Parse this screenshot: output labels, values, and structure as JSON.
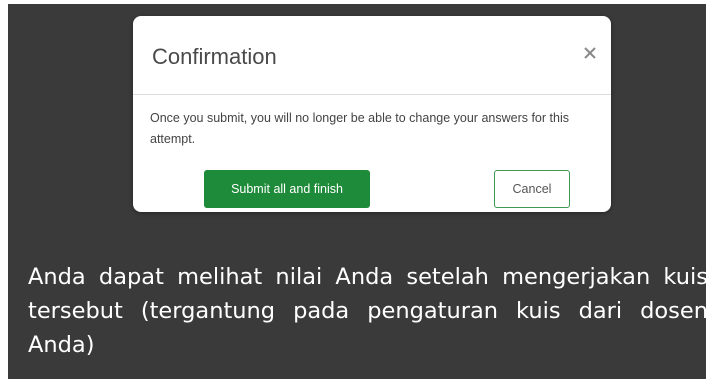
{
  "dialog": {
    "title": "Confirmation",
    "close_icon": "close-icon",
    "message": "Once you submit, you will no longer be able to change your answers for this attempt.",
    "primary_button_label": "Submit all and finish",
    "secondary_button_label": "Cancel"
  },
  "caption": {
    "line1": "Anda dapat melihat nilai Anda setelah",
    "line2": "mengerjakan kuis tersebut (tergantung pada",
    "line3": "pengaturan kuis dari dosen Anda)"
  },
  "colors": {
    "background": "#3a3a3a",
    "primary_button": "#1e8b3a",
    "secondary_button_border": "#3d9a55",
    "caption_text": "#ffffff"
  }
}
